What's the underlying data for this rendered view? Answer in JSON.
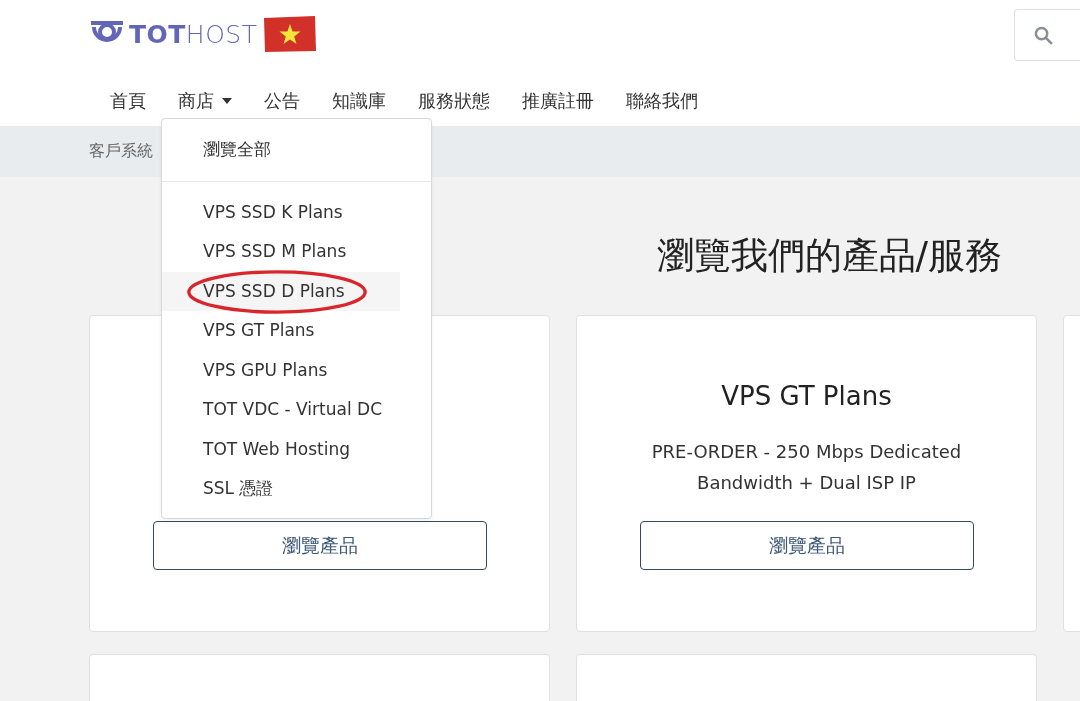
{
  "header": {
    "logo": {
      "text": "**TOT**HOST"
    },
    "search_button": {
      "kind": "search"
    }
  },
  "nav": [
    {
      "label": "首頁",
      "has_menu": false,
      "expanded": false
    },
    {
      "label": "商店",
      "has_menu": true,
      "expanded": true
    },
    {
      "label": "公告",
      "has_menu": false,
      "expanded": false
    },
    {
      "label": "知識庫",
      "has_menu": false,
      "expanded": false
    },
    {
      "label": "服務狀態",
      "has_menu": false,
      "expanded": false
    },
    {
      "label": "推廣註冊",
      "has_menu": false,
      "expanded": false
    },
    {
      "label": "聯絡我們",
      "has_menu": false,
      "expanded": false
    }
  ],
  "dropdown": {
    "header_item": "瀏覽全部",
    "items": [
      {
        "label": "VPS SSD K Plans",
        "selected": false,
        "annotated": false
      },
      {
        "label": "VPS SSD M Plans",
        "selected": false,
        "annotated": false
      },
      {
        "label": "VPS SSD D Plans",
        "selected": true,
        "annotated": true
      },
      {
        "label": "VPS GT Plans",
        "selected": false,
        "annotated": false
      },
      {
        "label": "VPS GPU Plans",
        "selected": false,
        "annotated": false
      },
      {
        "label": "TOT VDC - Virtual DC",
        "selected": false,
        "annotated": false
      },
      {
        "label": "TOT Web Hosting",
        "selected": false,
        "annotated": false
      },
      {
        "label": "SSL 憑證",
        "selected": false,
        "annotated": false
      }
    ]
  },
  "breadcrumb": [
    "客戶系統"
  ],
  "page_title": "瀏覽我們的產品/服務",
  "cards": [
    {
      "kind": "product",
      "button": "瀏覽產品"
    },
    {
      "kind": "product",
      "title": "VPS GT Plans",
      "description": "PRE-ORDER - 250 Mbps Dedicated Bandwidth + Dual ISP IP",
      "button": "瀏覽產品"
    },
    {
      "kind": "blank"
    },
    {
      "kind": "blank"
    },
    {
      "kind": "blank"
    }
  ]
}
